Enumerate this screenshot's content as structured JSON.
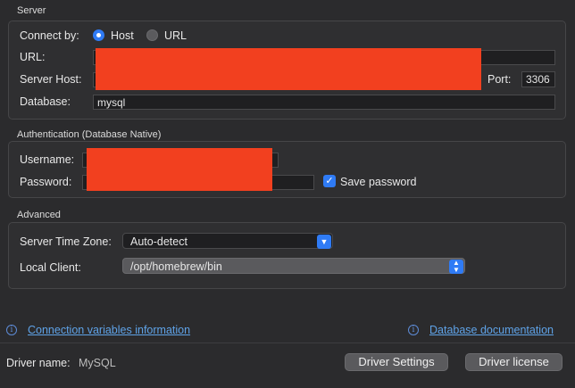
{
  "server": {
    "section_title": "Server",
    "connect_by_label": "Connect by:",
    "option_host": "Host",
    "option_url": "URL",
    "url_label": "URL:",
    "server_host_label": "Server Host:",
    "port_label": "Port:",
    "port_value": "3306",
    "database_label": "Database:",
    "database_value": "mysql"
  },
  "auth": {
    "section_title": "Authentication (Database Native)",
    "username_label": "Username:",
    "password_label": "Password:",
    "save_password_label": "Save password"
  },
  "advanced": {
    "section_title": "Advanced",
    "timezone_label": "Server Time Zone:",
    "timezone_value": "Auto-detect",
    "local_client_label": "Local Client:",
    "local_client_value": "/opt/homebrew/bin"
  },
  "links": {
    "connection_variables": "Connection variables information",
    "database_documentation": "Database documentation"
  },
  "footer": {
    "driver_name_label": "Driver name:",
    "driver_name_value": "MySQL",
    "driver_settings_button": "Driver Settings",
    "driver_license_button": "Driver license"
  },
  "colors": {
    "accent": "#2f7bf5",
    "redaction": "#f2401f",
    "link": "#5fa3e8"
  }
}
